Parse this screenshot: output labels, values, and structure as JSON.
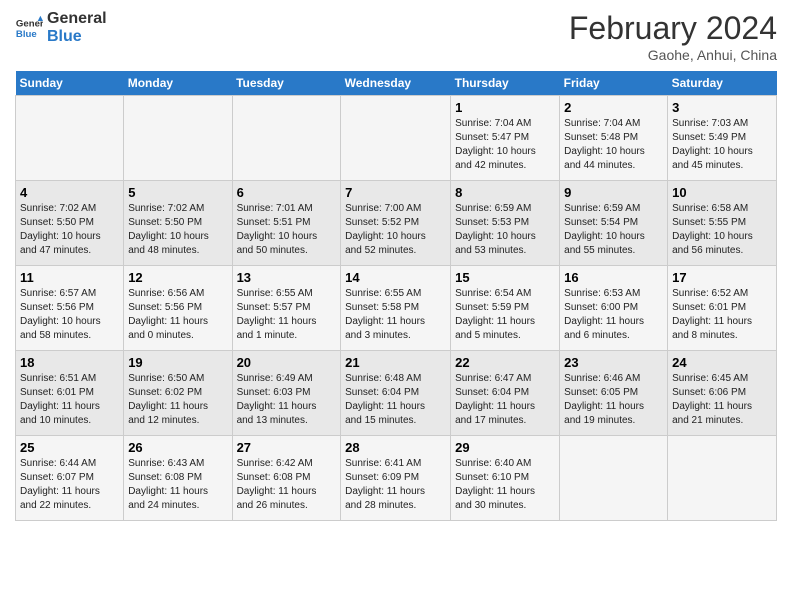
{
  "header": {
    "logo_line1": "General",
    "logo_line2": "Blue",
    "month": "February 2024",
    "location": "Gaohe, Anhui, China"
  },
  "weekdays": [
    "Sunday",
    "Monday",
    "Tuesday",
    "Wednesday",
    "Thursday",
    "Friday",
    "Saturday"
  ],
  "weeks": [
    [
      {
        "day": "",
        "detail": ""
      },
      {
        "day": "",
        "detail": ""
      },
      {
        "day": "",
        "detail": ""
      },
      {
        "day": "",
        "detail": ""
      },
      {
        "day": "1",
        "detail": "Sunrise: 7:04 AM\nSunset: 5:47 PM\nDaylight: 10 hours\nand 42 minutes."
      },
      {
        "day": "2",
        "detail": "Sunrise: 7:04 AM\nSunset: 5:48 PM\nDaylight: 10 hours\nand 44 minutes."
      },
      {
        "day": "3",
        "detail": "Sunrise: 7:03 AM\nSunset: 5:49 PM\nDaylight: 10 hours\nand 45 minutes."
      }
    ],
    [
      {
        "day": "4",
        "detail": "Sunrise: 7:02 AM\nSunset: 5:50 PM\nDaylight: 10 hours\nand 47 minutes."
      },
      {
        "day": "5",
        "detail": "Sunrise: 7:02 AM\nSunset: 5:50 PM\nDaylight: 10 hours\nand 48 minutes."
      },
      {
        "day": "6",
        "detail": "Sunrise: 7:01 AM\nSunset: 5:51 PM\nDaylight: 10 hours\nand 50 minutes."
      },
      {
        "day": "7",
        "detail": "Sunrise: 7:00 AM\nSunset: 5:52 PM\nDaylight: 10 hours\nand 52 minutes."
      },
      {
        "day": "8",
        "detail": "Sunrise: 6:59 AM\nSunset: 5:53 PM\nDaylight: 10 hours\nand 53 minutes."
      },
      {
        "day": "9",
        "detail": "Sunrise: 6:59 AM\nSunset: 5:54 PM\nDaylight: 10 hours\nand 55 minutes."
      },
      {
        "day": "10",
        "detail": "Sunrise: 6:58 AM\nSunset: 5:55 PM\nDaylight: 10 hours\nand 56 minutes."
      }
    ],
    [
      {
        "day": "11",
        "detail": "Sunrise: 6:57 AM\nSunset: 5:56 PM\nDaylight: 10 hours\nand 58 minutes."
      },
      {
        "day": "12",
        "detail": "Sunrise: 6:56 AM\nSunset: 5:56 PM\nDaylight: 11 hours\nand 0 minutes."
      },
      {
        "day": "13",
        "detail": "Sunrise: 6:55 AM\nSunset: 5:57 PM\nDaylight: 11 hours\nand 1 minute."
      },
      {
        "day": "14",
        "detail": "Sunrise: 6:55 AM\nSunset: 5:58 PM\nDaylight: 11 hours\nand 3 minutes."
      },
      {
        "day": "15",
        "detail": "Sunrise: 6:54 AM\nSunset: 5:59 PM\nDaylight: 11 hours\nand 5 minutes."
      },
      {
        "day": "16",
        "detail": "Sunrise: 6:53 AM\nSunset: 6:00 PM\nDaylight: 11 hours\nand 6 minutes."
      },
      {
        "day": "17",
        "detail": "Sunrise: 6:52 AM\nSunset: 6:01 PM\nDaylight: 11 hours\nand 8 minutes."
      }
    ],
    [
      {
        "day": "18",
        "detail": "Sunrise: 6:51 AM\nSunset: 6:01 PM\nDaylight: 11 hours\nand 10 minutes."
      },
      {
        "day": "19",
        "detail": "Sunrise: 6:50 AM\nSunset: 6:02 PM\nDaylight: 11 hours\nand 12 minutes."
      },
      {
        "day": "20",
        "detail": "Sunrise: 6:49 AM\nSunset: 6:03 PM\nDaylight: 11 hours\nand 13 minutes."
      },
      {
        "day": "21",
        "detail": "Sunrise: 6:48 AM\nSunset: 6:04 PM\nDaylight: 11 hours\nand 15 minutes."
      },
      {
        "day": "22",
        "detail": "Sunrise: 6:47 AM\nSunset: 6:04 PM\nDaylight: 11 hours\nand 17 minutes."
      },
      {
        "day": "23",
        "detail": "Sunrise: 6:46 AM\nSunset: 6:05 PM\nDaylight: 11 hours\nand 19 minutes."
      },
      {
        "day": "24",
        "detail": "Sunrise: 6:45 AM\nSunset: 6:06 PM\nDaylight: 11 hours\nand 21 minutes."
      }
    ],
    [
      {
        "day": "25",
        "detail": "Sunrise: 6:44 AM\nSunset: 6:07 PM\nDaylight: 11 hours\nand 22 minutes."
      },
      {
        "day": "26",
        "detail": "Sunrise: 6:43 AM\nSunset: 6:08 PM\nDaylight: 11 hours\nand 24 minutes."
      },
      {
        "day": "27",
        "detail": "Sunrise: 6:42 AM\nSunset: 6:08 PM\nDaylight: 11 hours\nand 26 minutes."
      },
      {
        "day": "28",
        "detail": "Sunrise: 6:41 AM\nSunset: 6:09 PM\nDaylight: 11 hours\nand 28 minutes."
      },
      {
        "day": "29",
        "detail": "Sunrise: 6:40 AM\nSunset: 6:10 PM\nDaylight: 11 hours\nand 30 minutes."
      },
      {
        "day": "",
        "detail": ""
      },
      {
        "day": "",
        "detail": ""
      }
    ]
  ]
}
